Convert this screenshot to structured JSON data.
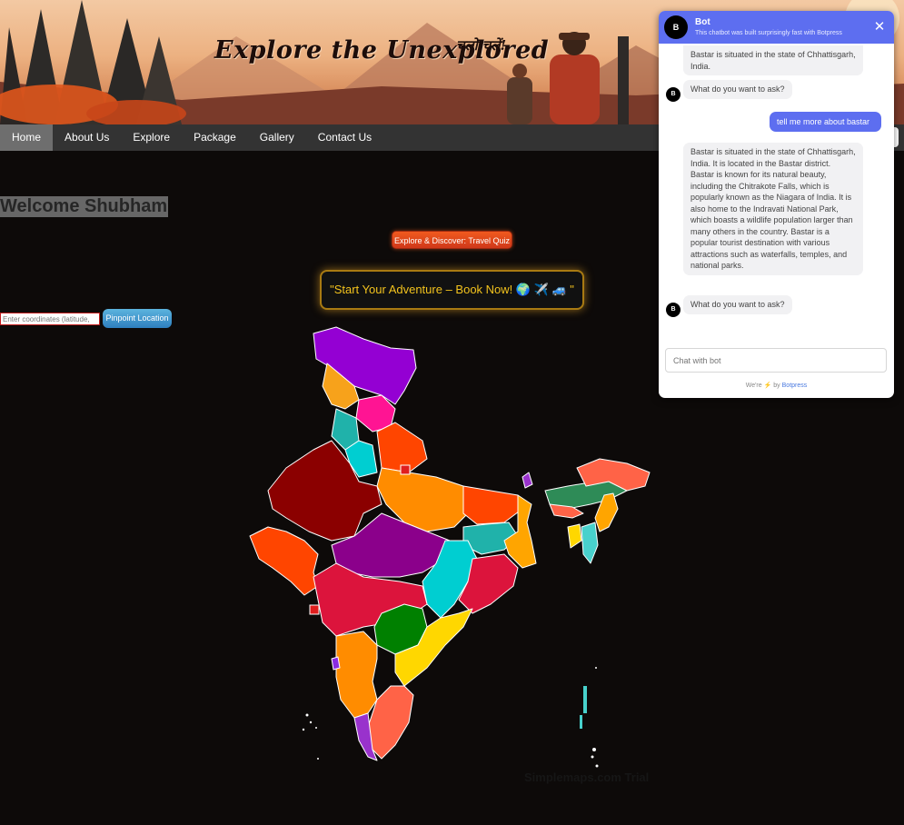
{
  "banner": {
    "title": "Explore the Unexplored",
    "subtitle": "चलो चलें!"
  },
  "nav": {
    "items": [
      {
        "label": "Home",
        "active": true
      },
      {
        "label": "About Us",
        "active": false
      },
      {
        "label": "Explore",
        "active": false
      },
      {
        "label": "Package",
        "active": false
      },
      {
        "label": "Gallery",
        "active": false
      },
      {
        "label": "Contact Us",
        "active": false
      }
    ]
  },
  "main": {
    "welcome": "Welcome Shubham",
    "quiz_button": "Explore & Discover: Travel Quiz",
    "adventure_button": "\"Start Your Adventure – Book Now! 🌍 ✈️ 🚙 \"",
    "coord_placeholder": "Enter coordinates (latitude,",
    "pinpoint_button": "Pinpoint Location",
    "watermark": "Simplemaps.com Trial"
  },
  "chat": {
    "avatar_letter": "B",
    "bot_name": "Bot",
    "description": "This chatbot was built surprisingly fast with Botpress",
    "messages": [
      {
        "from": "bot",
        "text": "Bastar is situated in the state of Chhattisgarh, India."
      },
      {
        "from": "bot",
        "text": "What do you want to ask?"
      },
      {
        "from": "user",
        "text": "tell me more about bastar"
      },
      {
        "from": "bot",
        "text": "Bastar is situated in the state of Chhattisgarh, India. It is located in the Bastar district. Bastar is known for its natural beauty, including the Chitrakote Falls, which is popularly known as the Niagara of India. It is also home to the Indravati National Park, which boasts a wildlife population larger than many others in the country. Bastar is a popular tourist destination with various attractions such as waterfalls, temples, and national parks."
      },
      {
        "from": "bot",
        "text": "What do you want to ask?"
      }
    ],
    "input_placeholder": "Chat with bot",
    "footer_prefix": "We're",
    "footer_by": "by",
    "footer_brand": "Botpress"
  },
  "colors": {
    "nav_bg": "#333333",
    "chat_accent": "#5d6ef0",
    "quiz_orange": "#f05a1e",
    "adventure_gold": "#f3c31d"
  }
}
